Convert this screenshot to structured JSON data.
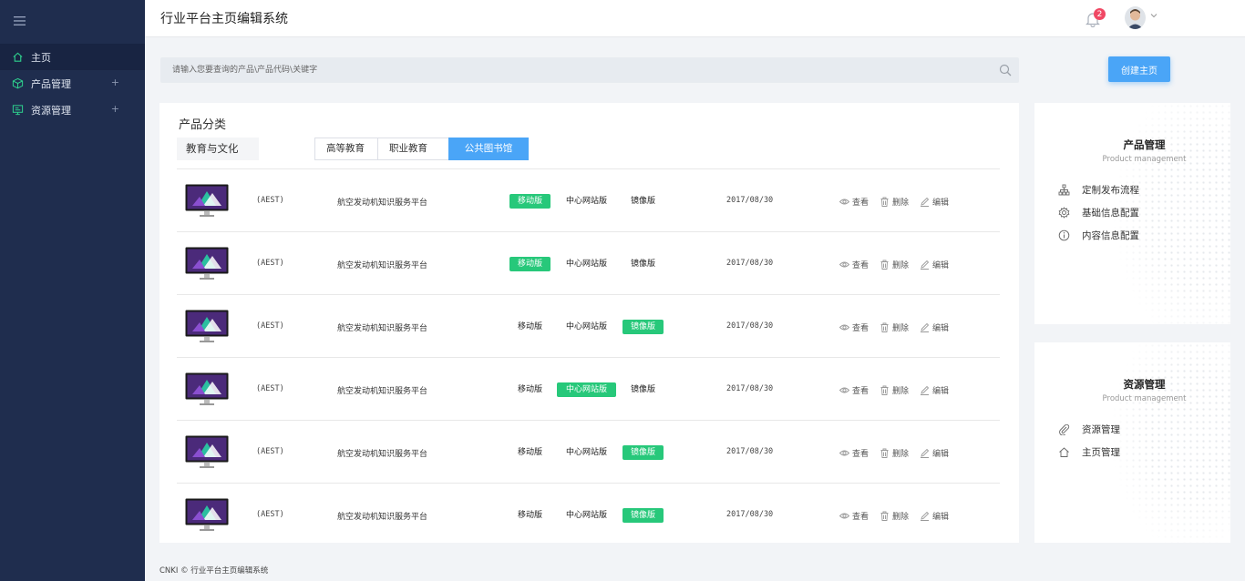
{
  "app": {
    "title": "行业平台主页编辑系统",
    "notification_count": "2"
  },
  "sidebar": {
    "items": [
      {
        "label": "主页",
        "icon": "home-icon",
        "active": true
      },
      {
        "label": "产品管理",
        "icon": "cube-icon",
        "expand": "+"
      },
      {
        "label": "资源管理",
        "icon": "monitor-icon",
        "expand": "+"
      }
    ]
  },
  "search": {
    "placeholder": "请输入您要查询的产品\\产品代码\\关键字"
  },
  "create_button": "创建主页",
  "main": {
    "title": "产品分类",
    "category": "教育与文化",
    "tabs": [
      {
        "label": "高等教育"
      },
      {
        "label": "职业教育"
      },
      {
        "label": "公共图书馆",
        "active": true
      }
    ],
    "rows": [
      {
        "code": "(AEST)",
        "name": "航空发动机知识服务平台",
        "mobile": "移动版",
        "center": "中心网站版",
        "mirror": "镜像版",
        "active": "mobile",
        "date": "2017/08/30",
        "view": "查看",
        "delete": "删除",
        "edit": "编辑"
      },
      {
        "code": "(AEST)",
        "name": "航空发动机知识服务平台",
        "mobile": "移动版",
        "center": "中心网站版",
        "mirror": "镜像版",
        "active": "mobile",
        "date": "2017/08/30",
        "view": "查看",
        "delete": "删除",
        "edit": "编辑"
      },
      {
        "code": "(AEST)",
        "name": "航空发动机知识服务平台",
        "mobile": "移动版",
        "center": "中心网站版",
        "mirror": "镜像版",
        "active": "mirror",
        "date": "2017/08/30",
        "view": "查看",
        "delete": "删除",
        "edit": "编辑"
      },
      {
        "code": "(AEST)",
        "name": "航空发动机知识服务平台",
        "mobile": "移动版",
        "center": "中心网站版",
        "mirror": "镜像版",
        "active": "center",
        "date": "2017/08/30",
        "view": "查看",
        "delete": "删除",
        "edit": "编辑"
      },
      {
        "code": "(AEST)",
        "name": "航空发动机知识服务平台",
        "mobile": "移动版",
        "center": "中心网站版",
        "mirror": "镜像版",
        "active": "mirror",
        "date": "2017/08/30",
        "view": "查看",
        "delete": "删除",
        "edit": "编辑"
      },
      {
        "code": "(AEST)",
        "name": "航空发动机知识服务平台",
        "mobile": "移动版",
        "center": "中心网站版",
        "mirror": "镜像版",
        "active": "mirror",
        "date": "2017/08/30",
        "view": "查看",
        "delete": "删除",
        "edit": "编辑"
      }
    ]
  },
  "product_panel": {
    "title": "产品管理",
    "subtitle": "Product management",
    "items": [
      {
        "label": "定制发布流程",
        "icon": "sitemap-icon"
      },
      {
        "label": "基础信息配置",
        "icon": "gear-icon"
      },
      {
        "label": "内容信息配置",
        "icon": "info-icon"
      }
    ]
  },
  "resource_panel": {
    "title": "资源管理",
    "subtitle": "Product management",
    "items": [
      {
        "label": "资源管理",
        "icon": "paperclip-icon"
      },
      {
        "label": "主页管理",
        "icon": "home-icon"
      }
    ]
  },
  "footer": "CNKI © 行业平台主页编辑系统",
  "colors": {
    "sidebar": "#1f2d4e",
    "accent": "#4aa5f7",
    "active_badge": "#27c87a",
    "notification": "#f04864"
  }
}
